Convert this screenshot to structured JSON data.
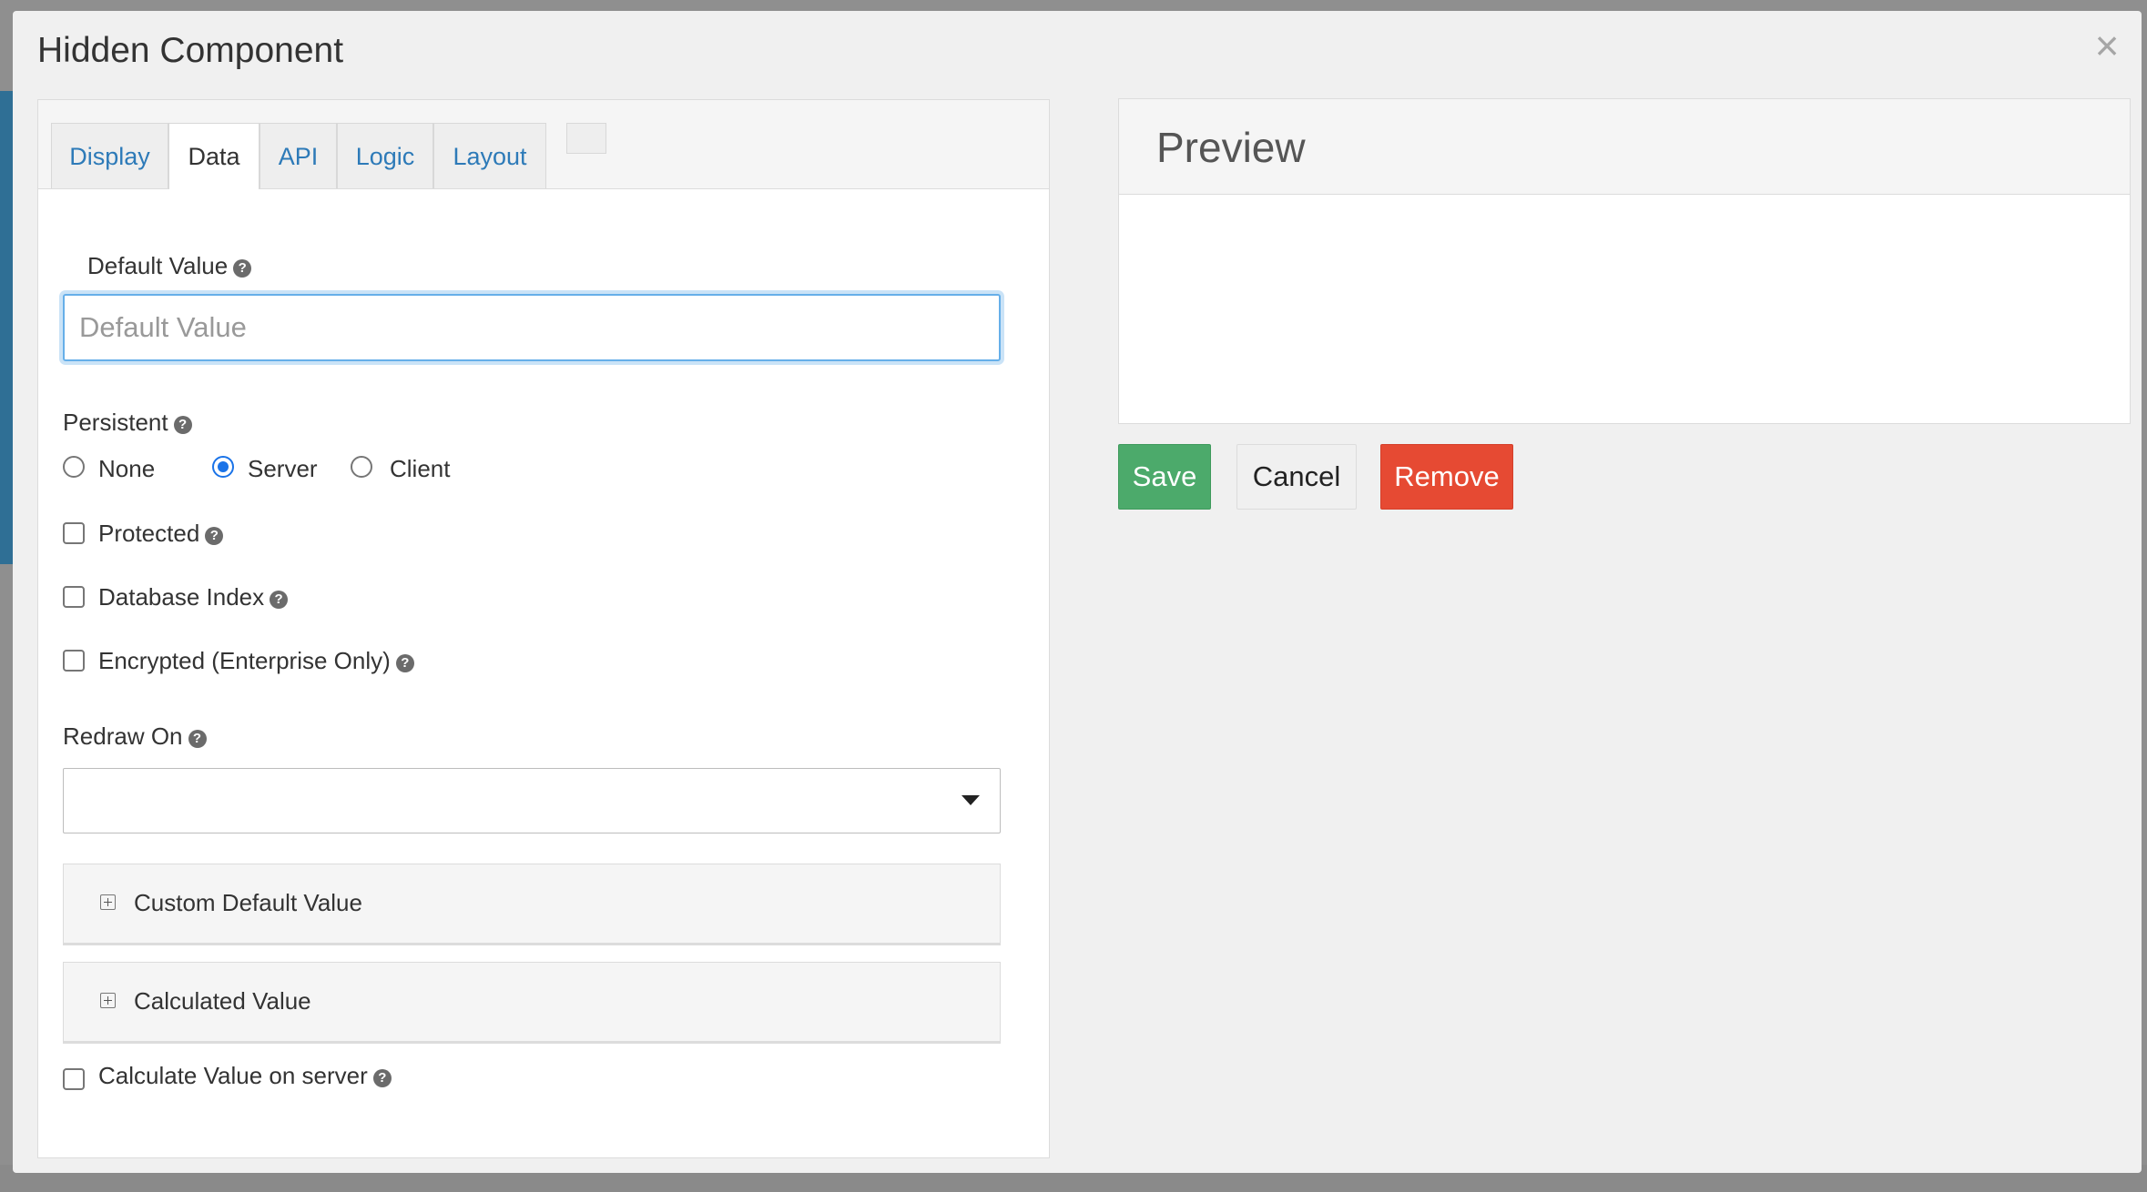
{
  "modal": {
    "title": "Hidden Component",
    "close_symbol": "×"
  },
  "tabs": [
    {
      "label": "Display",
      "active": false
    },
    {
      "label": "Data",
      "active": true
    },
    {
      "label": "API",
      "active": false
    },
    {
      "label": "Logic",
      "active": false
    },
    {
      "label": "Layout",
      "active": false
    }
  ],
  "form": {
    "default_value": {
      "label": "Default Value",
      "placeholder": "Default Value",
      "value": ""
    },
    "persistent": {
      "label": "Persistent",
      "options": [
        "None",
        "Server",
        "Client"
      ],
      "selected": "Server"
    },
    "protected_label": "Protected",
    "database_index_label": "Database Index",
    "encrypted_label": "Encrypted (Enterprise Only)",
    "redraw_on": {
      "label": "Redraw On",
      "value": ""
    },
    "panels": [
      "Custom Default Value",
      "Calculated Value"
    ],
    "calculate_server_label": "Calculate Value on server",
    "help_symbol": "?"
  },
  "preview": {
    "title": "Preview"
  },
  "buttons": {
    "save": "Save",
    "cancel": "Cancel",
    "remove": "Remove"
  },
  "colors": {
    "save": "#4caa6b",
    "remove": "#e64a33",
    "tab_link": "#2d7ab8",
    "focus_ring": "#66afe9",
    "radio_checked": "#1a73e8"
  },
  "icons": {
    "close": "close-icon",
    "help": "question-circle-icon",
    "dropdown": "caret-down-icon",
    "expand": "plus-square-icon"
  }
}
